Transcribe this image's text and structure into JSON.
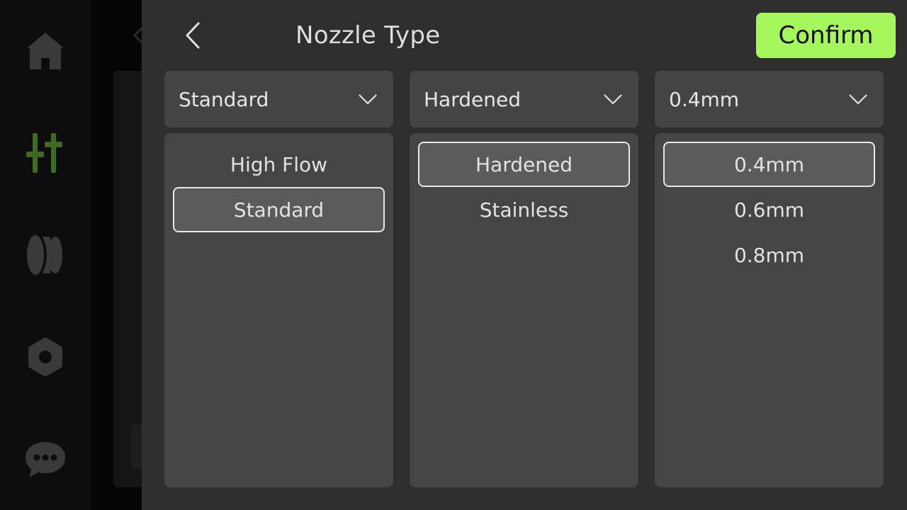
{
  "header": {
    "title": "Nozzle Type",
    "confirm_label": "Confirm"
  },
  "background_nav": {
    "icons": [
      "home-icon",
      "tune-icon",
      "filament-icon",
      "settings-nut-icon",
      "chat-icon"
    ],
    "active_color": "#4a7a2a"
  },
  "selectors": [
    {
      "selected": "Standard",
      "options": [
        "High Flow",
        "Standard"
      ],
      "selected_index": 1
    },
    {
      "selected": "Hardened",
      "options": [
        "Hardened",
        "Stainless"
      ],
      "selected_index": 0
    },
    {
      "selected": "0.4mm",
      "options": [
        "0.4mm",
        "0.6mm",
        "0.8mm"
      ],
      "selected_index": 0
    }
  ],
  "colors": {
    "accent": "#a6f75d",
    "overlay_bg": "#2e2e2e",
    "panel_bg": "#454545"
  }
}
